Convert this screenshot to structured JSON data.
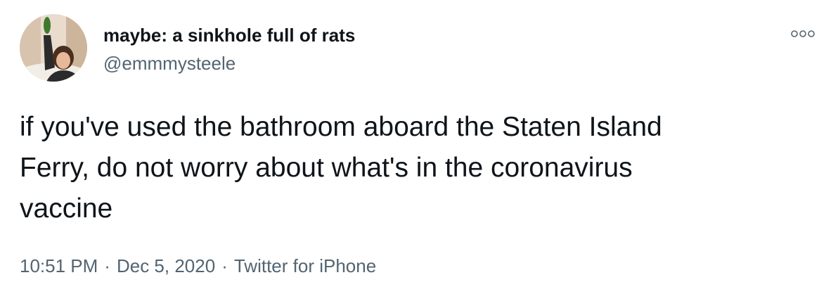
{
  "author": {
    "display_name": "maybe: a sinkhole full of rats",
    "handle": "@emmmysteele",
    "avatar_icon": "profile-photo"
  },
  "more_menu_icon": "more-dots-icon",
  "tweet": {
    "text": "if you've used the bathroom aboard the Staten Island\nFerry, do not worry about what's in the coronavirus\nvaccine"
  },
  "meta": {
    "time": "10:51 PM",
    "separator": "·",
    "date": "Dec 5, 2020",
    "source": "Twitter for iPhone"
  },
  "colors": {
    "text_primary": "#0f1419",
    "text_secondary": "#536471",
    "background": "#ffffff"
  }
}
